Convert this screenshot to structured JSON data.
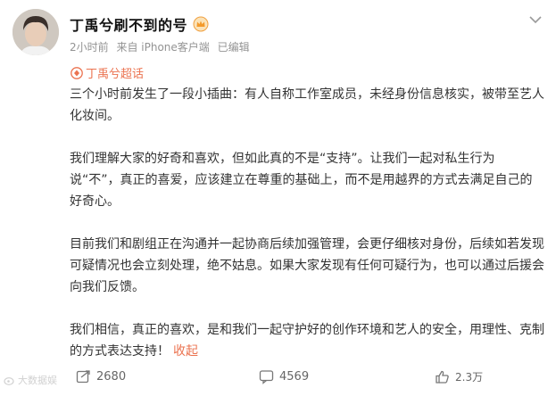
{
  "author": {
    "name": "丁禹兮刷不到的号",
    "avatar_icon": "avatar-photo",
    "badge_icon": "vip-crown-icon"
  },
  "meta": {
    "time": "2小时前",
    "source": "来自 iPhone客户端",
    "edited": "已编辑"
  },
  "topic": {
    "label": "丁禹兮超话",
    "icon": "supertopic-diamond-icon",
    "color": "#eb7350"
  },
  "content": {
    "paragraphs": [
      "三个小时前发生了一段小插曲：有人自称工作室成员，未经身份信息核实，被带至艺人化妆间。",
      "我们理解大家的好奇和喜欢，但如此真的不是“支持”。让我们一起对私生行为说“不”，真正的喜爱，应该建立在尊重的基础上，而不是用越界的方式去满足自己的好奇心。",
      "目前我们和剧组正在沟通并一起协商后续加强管理，会更仔细核对身份，后续如若发现可疑情况也会立刻处理，绝不姑息。如果大家发现有任何可疑行为，也可以通过后援会向我们反馈。",
      "我们相信，真正的喜欢，是和我们一起守护好的创作环境和艺人的安全，用理性、克制的方式表达支持！"
    ],
    "collapse_label": "收起"
  },
  "actions": {
    "repost_count": "2680",
    "comment_count": "4569",
    "like_count": "2.3万"
  },
  "watermark": {
    "text": "大数据娱"
  },
  "colors": {
    "accent": "#eb7350",
    "meta_text": "#939393",
    "body_text": "#333333"
  }
}
